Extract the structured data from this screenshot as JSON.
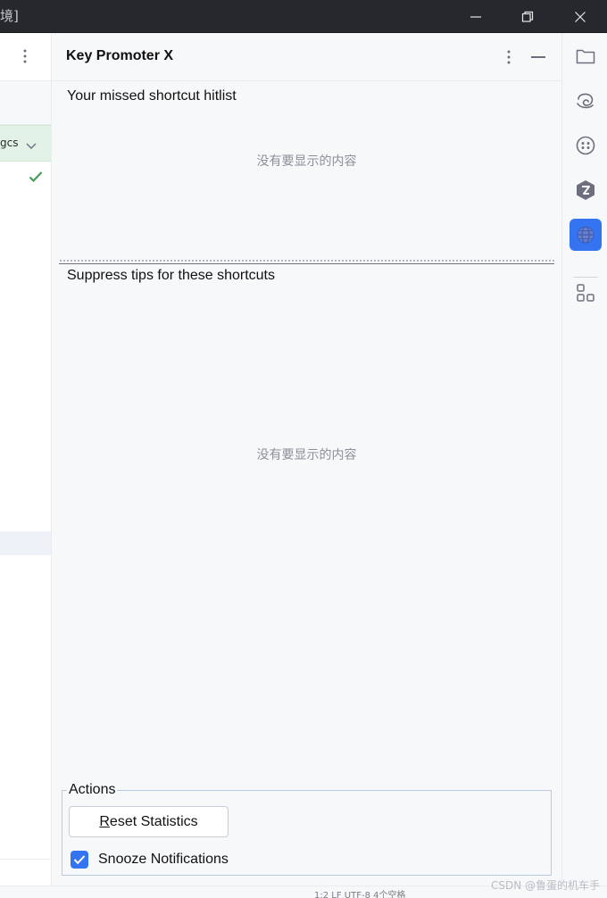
{
  "window": {
    "title_fragment": "境]",
    "controls": [
      "minimize-icon",
      "restore-icon",
      "close-icon"
    ]
  },
  "left_panel": {
    "row_text": "gcs",
    "icons": [
      "more-vertical-icon",
      "chevron-down-icon",
      "checkmark-icon"
    ]
  },
  "tool_window": {
    "title": "Key Promoter X",
    "hitlist_label": "Your missed shortcut hitlist",
    "hitlist_empty": "没有要显示的内容",
    "suppress_label": "Suppress tips for these shortcuts",
    "suppress_empty": "没有要显示的内容",
    "actions": {
      "legend": "Actions",
      "reset_button_mnemonic": "R",
      "reset_button_rest": "eset Statistics",
      "snooze_label": "Snooze Notifications",
      "snooze_checked": true
    }
  },
  "right_toolbar": {
    "icons": [
      "project-folder-icon",
      "ai-assistant-swirl-icon",
      "plugin-dots-icon",
      "jetbrains-logo-icon",
      "key-promoter-globe-icon",
      "structure-blocks-icon"
    ],
    "active": "key-promoter-globe-icon"
  },
  "status_bar": {
    "text": "1:2   LF   UTF-8   4个空格",
    "watermark": "CSDN @鲁蛋的机车手"
  },
  "colors": {
    "accent": "#3574f0",
    "titlebar": "#27282e",
    "panel_bg": "#f7f8fa",
    "green_row": "#e3f2e6"
  }
}
